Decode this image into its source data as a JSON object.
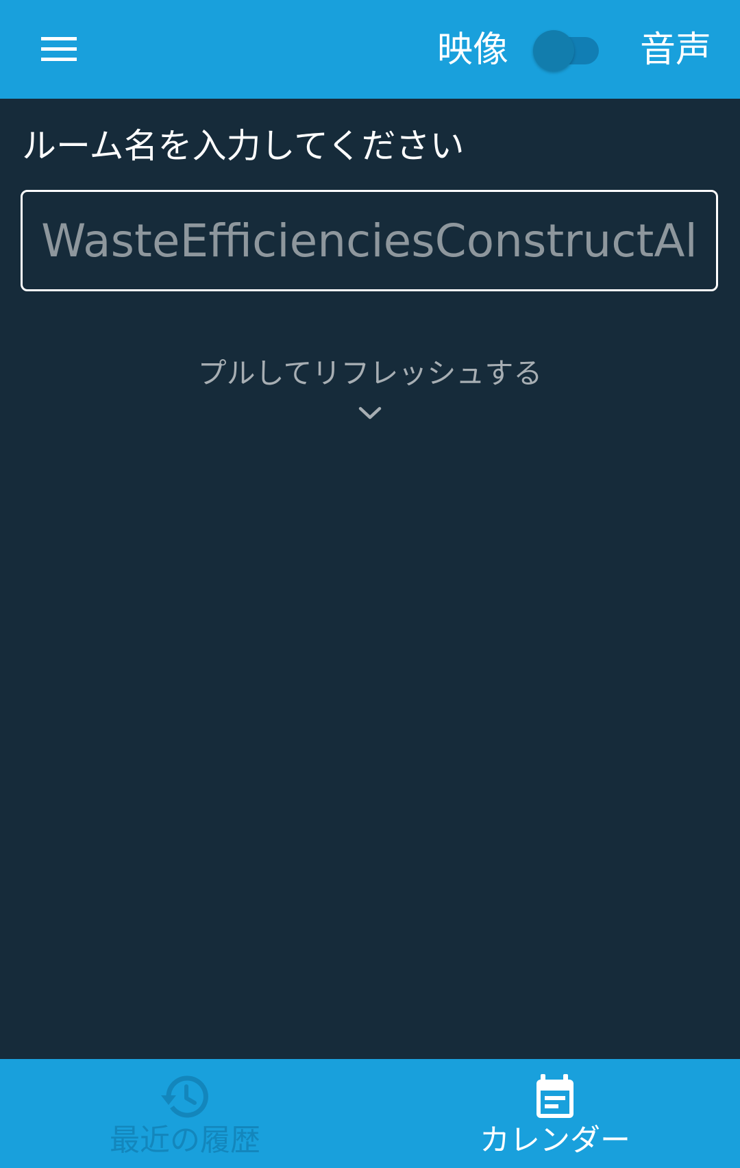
{
  "topbar": {
    "menu_icon": "menu-icon",
    "video_label": "映像",
    "audio_label": "音声",
    "toggle_state": "video"
  },
  "room": {
    "title": "ルーム名を入力してください",
    "placeholder": "WasteEfficienciesConstructAl",
    "value": ""
  },
  "pull_refresh": {
    "label": "プルしてリフレッシュする",
    "icon": "chevron-down-icon"
  },
  "bottom_nav": {
    "items": [
      {
        "label": "最近の履歴",
        "icon": "history-icon",
        "active": false
      },
      {
        "label": "カレンダー",
        "icon": "calendar-icon",
        "active": true
      }
    ]
  },
  "colors": {
    "primary": "#19a0dc",
    "background": "#162b3a",
    "inactive_nav": "#1386bc"
  }
}
